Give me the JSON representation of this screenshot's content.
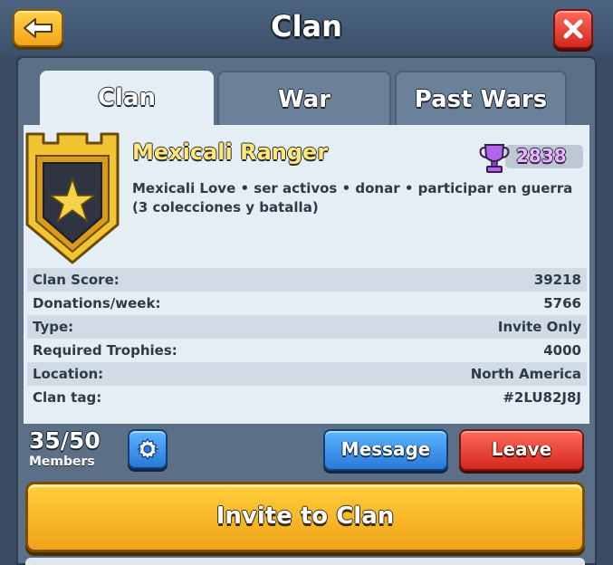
{
  "header": {
    "title": "Clan"
  },
  "tabs": [
    {
      "label": "Clan",
      "active": true
    },
    {
      "label": "War",
      "active": false
    },
    {
      "label": "Past Wars",
      "active": false
    }
  ],
  "clan": {
    "name": "Mexicali Ranger",
    "trophies": "2838",
    "description": "Mexicali Love • ser activos • donar • participar en guerra (3 colecciones y batalla)"
  },
  "stats": [
    {
      "label": "Clan Score:",
      "value": "39218"
    },
    {
      "label": "Donations/week:",
      "value": "5766"
    },
    {
      "label": "Type:",
      "value": "Invite Only"
    },
    {
      "label": "Required Trophies:",
      "value": "4000"
    },
    {
      "label": "Location:",
      "value": "North America"
    },
    {
      "label": "Clan tag:",
      "value": "#2LU82J8J"
    }
  ],
  "members": {
    "count": "35/50",
    "label": "Members"
  },
  "buttons": {
    "message": "Message",
    "leave": "Leave",
    "invite": "Invite to Clan"
  },
  "colors": {
    "accent_gold": "#f0a218",
    "accent_blue": "#2a78d8",
    "accent_red": "#d3281e",
    "trophy_purple": "#a04ad8"
  },
  "icons": {
    "back": "arrow-left-icon",
    "close": "close-icon",
    "trophy": "trophy-icon",
    "settings": "gear-icon",
    "badge": "clan-badge-icon"
  }
}
